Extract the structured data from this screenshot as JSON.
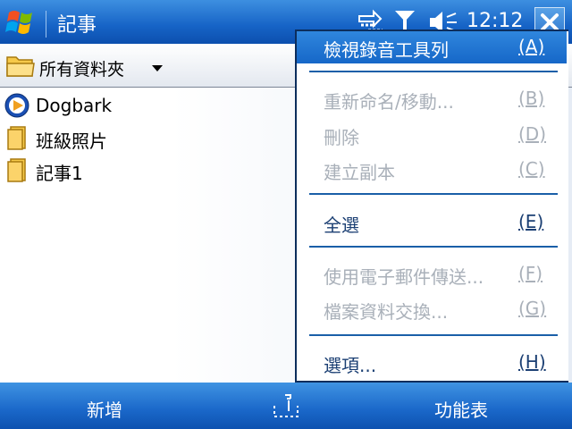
{
  "titlebar": {
    "title": "記事",
    "time": "12:12",
    "icons": [
      "windows-start-icon",
      "data-connection-icon",
      "signal-icon",
      "speaker-icon",
      "close-icon"
    ]
  },
  "folderbar": {
    "label": "所有資料夾",
    "icon": "folder-icon"
  },
  "files": [
    {
      "label": "Dogbark",
      "icon": "media-player-icon"
    },
    {
      "label": "班級照片",
      "icon": "folder-icon"
    },
    {
      "label": "記事1",
      "icon": "note-icon"
    }
  ],
  "menu": {
    "items": [
      {
        "label": "檢視錄音工具列",
        "key": "(A)",
        "state": "highlighted"
      },
      {
        "label": "重新命名/移動...",
        "key": "(B)",
        "state": "disabled"
      },
      {
        "label": "刪除",
        "key": "(D)",
        "state": "disabled"
      },
      {
        "label": "建立副本",
        "key": "(C)",
        "state": "disabled"
      },
      {
        "label": "全選",
        "key": "(E)",
        "state": "enabled"
      },
      {
        "label": "使用電子郵件傳送...",
        "key": "(F)",
        "state": "disabled"
      },
      {
        "label": "檔案資料交換...",
        "key": "(G)",
        "state": "disabled"
      },
      {
        "label": "選項...",
        "key": "(H)",
        "state": "enabled"
      }
    ]
  },
  "softkeys": {
    "left": "新增",
    "right": "功能表",
    "center_icon": "keyboard-icon"
  },
  "colors": {
    "bar_blue": "#1663c6",
    "highlight": "#2f86dd",
    "disabled_text": "#a9b0b9",
    "menu_text": "#1b3f73"
  }
}
